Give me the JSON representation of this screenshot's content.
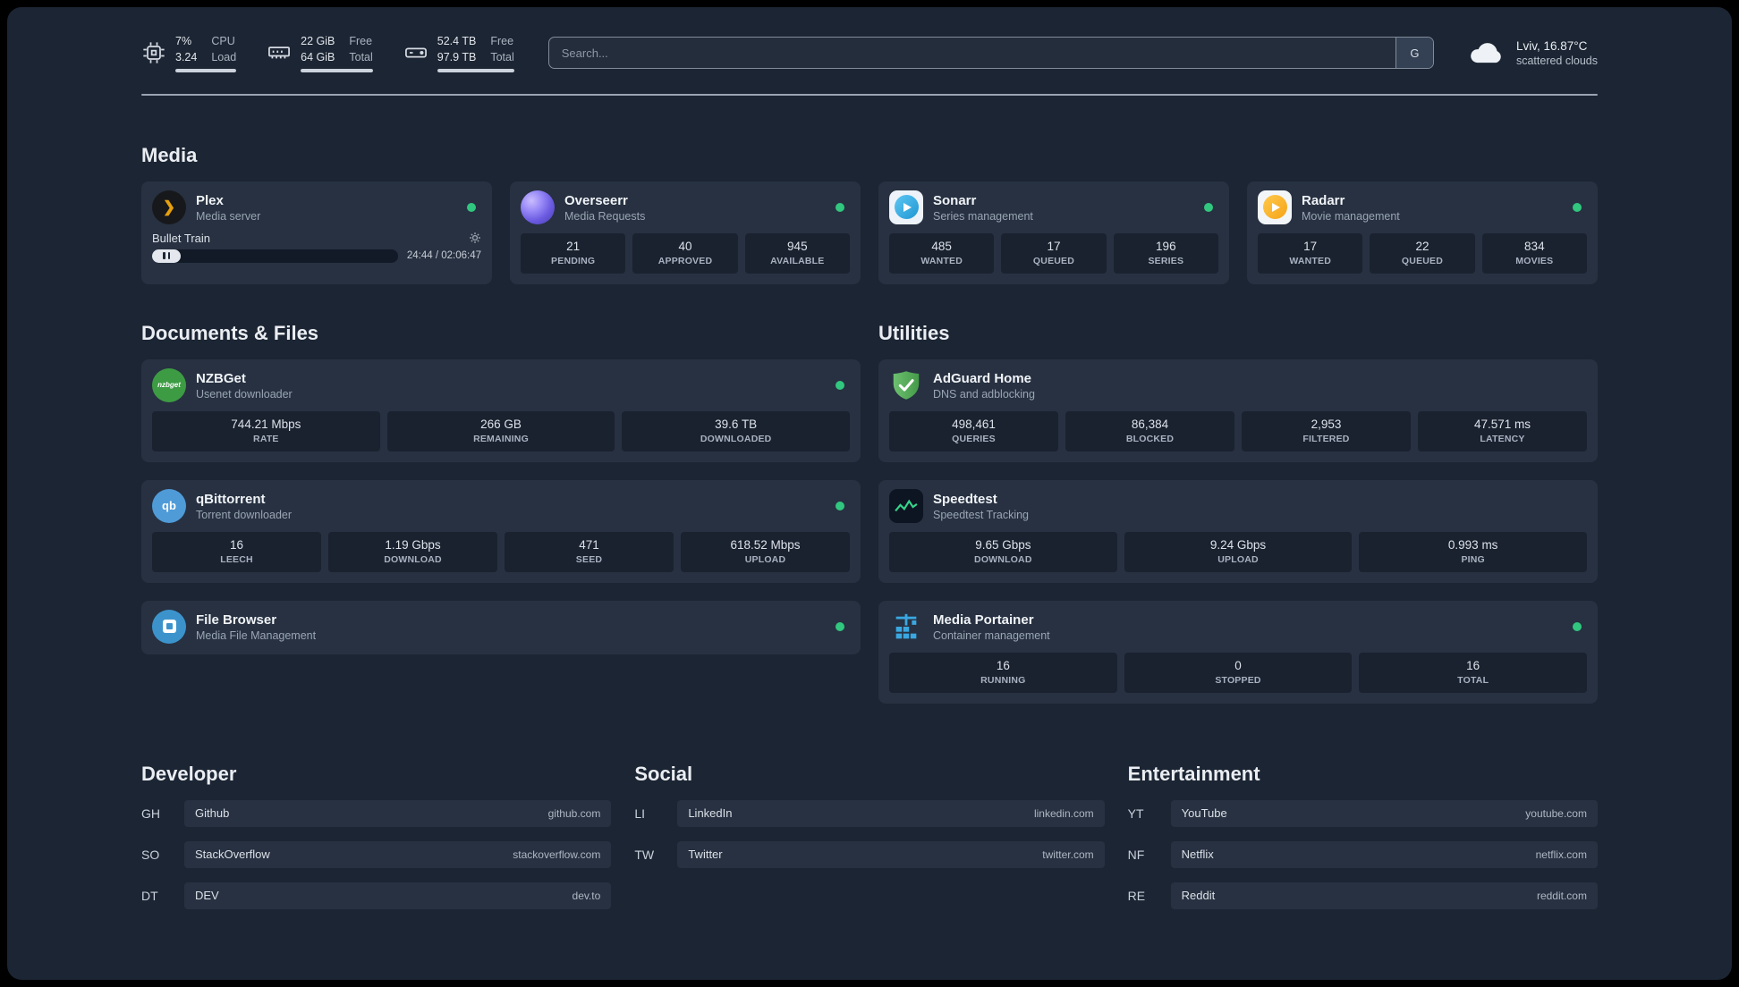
{
  "colors": {
    "status_online": "#31c77f",
    "plex_accent": "#e5a00d"
  },
  "header": {
    "cpu": {
      "value_top": "7%",
      "value_bottom": "3.24",
      "label_top": "CPU",
      "label_bottom": "Load"
    },
    "memory": {
      "value_top": "22 GiB",
      "value_bottom": "64 GiB",
      "label_top": "Free",
      "label_bottom": "Total"
    },
    "disk": {
      "value_top": "52.4 TB",
      "value_bottom": "97.9 TB",
      "label_top": "Free",
      "label_bottom": "Total"
    },
    "search": {
      "placeholder": "Search...",
      "provider": "G"
    },
    "weather": {
      "location": "Lviv, 16.87°C",
      "condition": "scattered clouds"
    }
  },
  "media": {
    "title": "Media",
    "cards": [
      {
        "name": "Plex",
        "desc": "Media server",
        "player": {
          "track": "Bullet Train",
          "time": "24:44 / 02:06:47"
        }
      },
      {
        "name": "Overseerr",
        "desc": "Media Requests",
        "stats": [
          {
            "value": "21",
            "label": "PENDING"
          },
          {
            "value": "40",
            "label": "APPROVED"
          },
          {
            "value": "945",
            "label": "AVAILABLE"
          }
        ]
      },
      {
        "name": "Sonarr",
        "desc": "Series management",
        "stats": [
          {
            "value": "485",
            "label": "WANTED"
          },
          {
            "value": "17",
            "label": "QUEUED"
          },
          {
            "value": "196",
            "label": "SERIES"
          }
        ]
      },
      {
        "name": "Radarr",
        "desc": "Movie management",
        "stats": [
          {
            "value": "17",
            "label": "WANTED"
          },
          {
            "value": "22",
            "label": "QUEUED"
          },
          {
            "value": "834",
            "label": "MOVIES"
          }
        ]
      }
    ]
  },
  "documents": {
    "title": "Documents & Files",
    "cards": [
      {
        "name": "NZBGet",
        "desc": "Usenet downloader",
        "icon_text": "nzbget",
        "stats": [
          {
            "value": "744.21 Mbps",
            "label": "RATE"
          },
          {
            "value": "266 GB",
            "label": "REMAINING"
          },
          {
            "value": "39.6 TB",
            "label": "DOWNLOADED"
          }
        ]
      },
      {
        "name": "qBittorrent",
        "desc": "Torrent downloader",
        "icon_text": "qb",
        "stats": [
          {
            "value": "16",
            "label": "LEECH"
          },
          {
            "value": "1.19 Gbps",
            "label": "DOWNLOAD"
          },
          {
            "value": "471",
            "label": "SEED"
          },
          {
            "value": "618.52 Mbps",
            "label": "UPLOAD"
          }
        ]
      },
      {
        "name": "File Browser",
        "desc": "Media File Management",
        "stats": []
      }
    ]
  },
  "utilities": {
    "title": "Utilities",
    "cards": [
      {
        "name": "AdGuard Home",
        "desc": "DNS and adblocking",
        "stats": [
          {
            "value": "498,461",
            "label": "QUERIES"
          },
          {
            "value": "86,384",
            "label": "BLOCKED"
          },
          {
            "value": "2,953",
            "label": "FILTERED"
          },
          {
            "value": "47.571 ms",
            "label": "LATENCY"
          }
        ]
      },
      {
        "name": "Speedtest",
        "desc": "Speedtest Tracking",
        "stats": [
          {
            "value": "9.65 Gbps",
            "label": "DOWNLOAD"
          },
          {
            "value": "9.24 Gbps",
            "label": "UPLOAD"
          },
          {
            "value": "0.993 ms",
            "label": "PING"
          }
        ]
      },
      {
        "name": "Media Portainer",
        "desc": "Container management",
        "stats": [
          {
            "value": "16",
            "label": "RUNNING"
          },
          {
            "value": "0",
            "label": "STOPPED"
          },
          {
            "value": "16",
            "label": "TOTAL"
          }
        ]
      }
    ]
  },
  "bookmarks": {
    "groups": [
      {
        "title": "Developer",
        "items": [
          {
            "abbr": "GH",
            "name": "Github",
            "domain": "github.com"
          },
          {
            "abbr": "SO",
            "name": "StackOverflow",
            "domain": "stackoverflow.com"
          },
          {
            "abbr": "DT",
            "name": "DEV",
            "domain": "dev.to"
          }
        ]
      },
      {
        "title": "Social",
        "items": [
          {
            "abbr": "LI",
            "name": "LinkedIn",
            "domain": "linkedin.com"
          },
          {
            "abbr": "TW",
            "name": "Twitter",
            "domain": "twitter.com"
          }
        ]
      },
      {
        "title": "Entertainment",
        "items": [
          {
            "abbr": "YT",
            "name": "YouTube",
            "domain": "youtube.com"
          },
          {
            "abbr": "NF",
            "name": "Netflix",
            "domain": "netflix.com"
          },
          {
            "abbr": "RE",
            "name": "Reddit",
            "domain": "reddit.com"
          }
        ]
      }
    ]
  }
}
